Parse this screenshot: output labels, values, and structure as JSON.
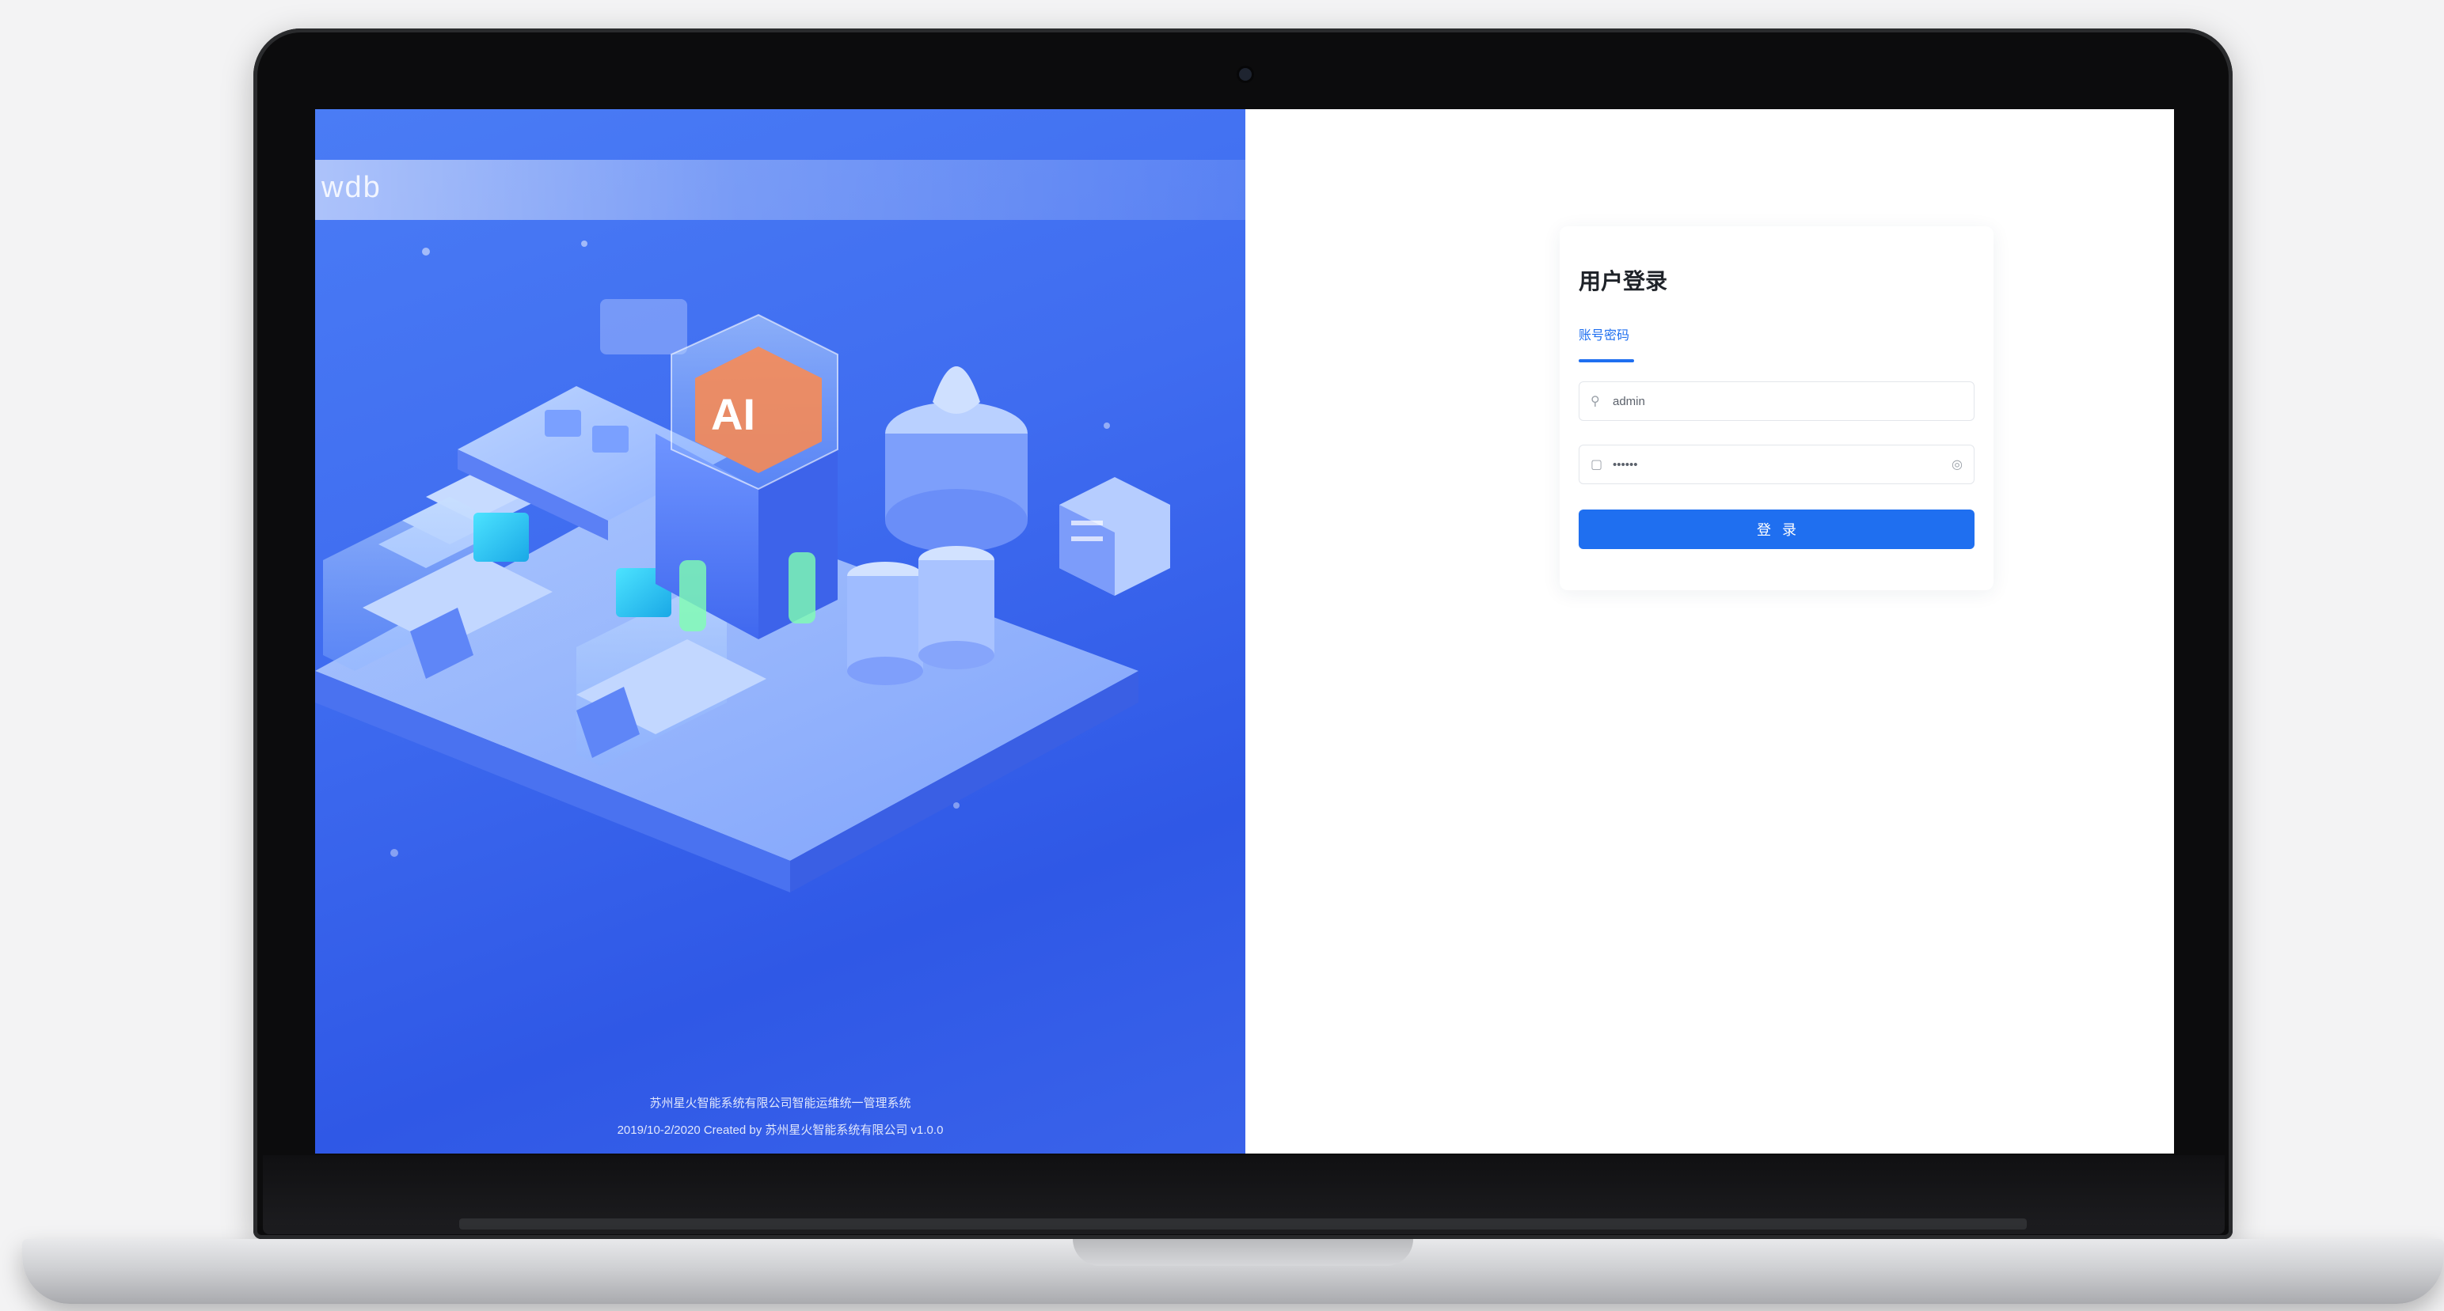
{
  "brand": {
    "logo_text": "wdb"
  },
  "illustration": {
    "cube_label": "AI",
    "icon": "isometric-datacenter-illustration"
  },
  "footer": {
    "line1": "苏州星火智能系统有限公司智能运维统一管理系统",
    "line2": "2019/10-2/2020 Created by 苏州星火智能系统有限公司 v1.0.0"
  },
  "login": {
    "title": "用户登录",
    "tab_label": "账号密码",
    "username_value": "admin",
    "password_value": "••••••",
    "submit_label": "登录"
  },
  "colors": {
    "accent": "#1f6ff0",
    "panel_blue": "#3f6cf0"
  }
}
